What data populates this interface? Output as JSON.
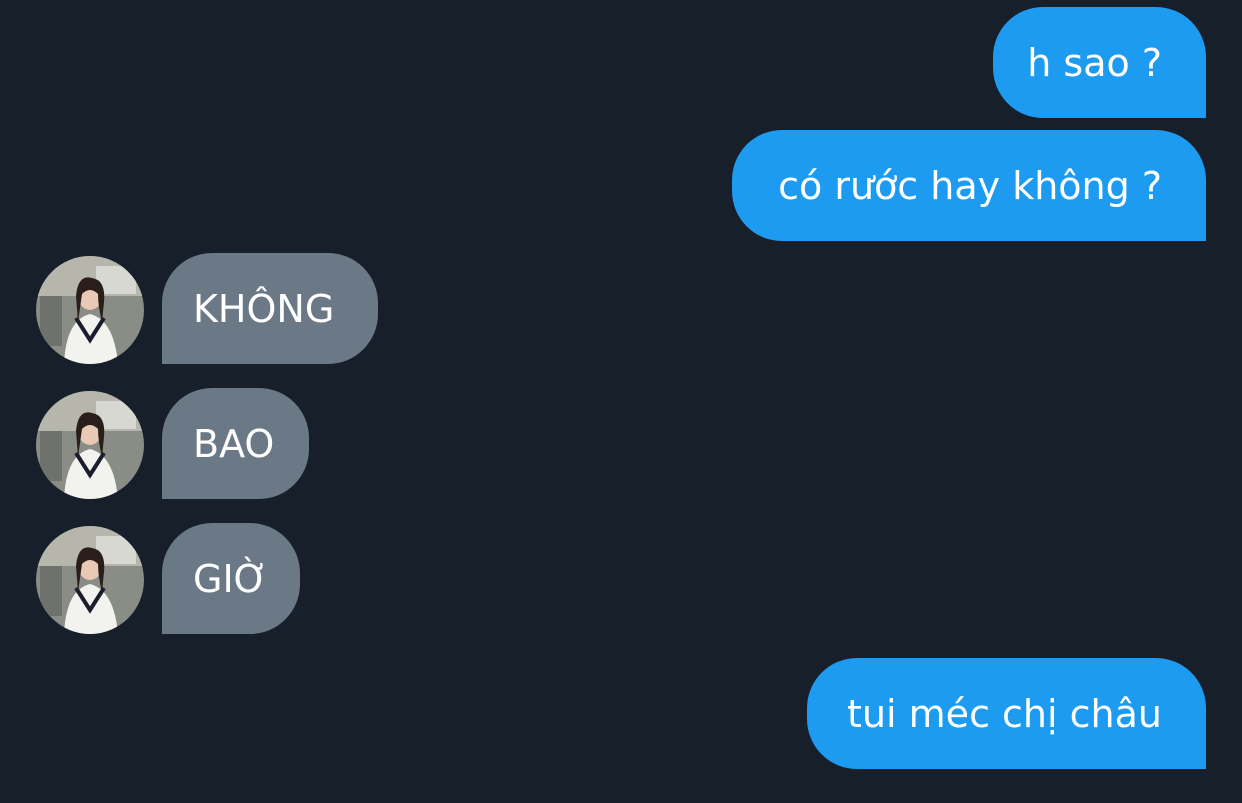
{
  "theme": {
    "background": "#171f2a",
    "sent_bubble": "#1d9bf0",
    "received_bubble": "#6b7886",
    "text": "#ffffff"
  },
  "messages": [
    {
      "direction": "sent",
      "text": "h sao ?"
    },
    {
      "direction": "sent",
      "text": "có rước hay không ?"
    },
    {
      "direction": "received",
      "text": "KHÔNG",
      "avatar": "contact-avatar"
    },
    {
      "direction": "received",
      "text": "BAO",
      "avatar": "contact-avatar"
    },
    {
      "direction": "received",
      "text": "GIỜ",
      "avatar": "contact-avatar"
    },
    {
      "direction": "sent",
      "text": "tui méc chị châu"
    }
  ]
}
